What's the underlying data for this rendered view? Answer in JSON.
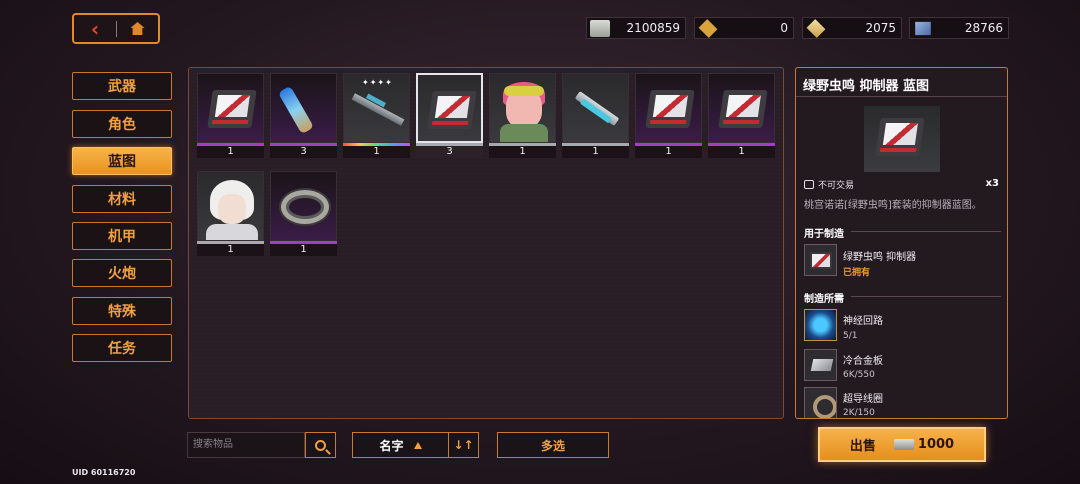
{
  "nav": {
    "back_icon": "chevron-left-icon",
    "home_icon": "home-icon"
  },
  "currencies": [
    {
      "icon": "cash-icon",
      "value": "2100859"
    },
    {
      "icon": "gold-crystal-icon",
      "value": "0"
    },
    {
      "icon": "crystal-shard-icon",
      "value": "2075"
    },
    {
      "icon": "cube-icon",
      "value": "28766"
    }
  ],
  "sidebar": {
    "active": "蓝图",
    "items": [
      {
        "label": "武器"
      },
      {
        "label": "角色"
      },
      {
        "label": "蓝图"
      },
      {
        "label": "材料"
      },
      {
        "label": "机甲"
      },
      {
        "label": "火炮"
      },
      {
        "label": "特殊"
      },
      {
        "label": "任务"
      }
    ]
  },
  "grid": {
    "items": [
      {
        "art": "suppressor-case",
        "count": "1",
        "rarity": "purple",
        "selected": false
      },
      {
        "art": "lightning-bolt",
        "count": "3",
        "rarity": "purple",
        "selected": false
      },
      {
        "art": "rifle",
        "count": "1",
        "rarity": "rainbow",
        "selected": false
      },
      {
        "art": "suppressor-case",
        "count": "3",
        "rarity": "gray",
        "selected": true
      },
      {
        "art": "character-pink",
        "count": "1",
        "rarity": "gray",
        "selected": false
      },
      {
        "art": "gun",
        "count": "1",
        "rarity": "gray",
        "selected": false
      },
      {
        "art": "suppressor-case",
        "count": "1",
        "rarity": "purple",
        "selected": false
      },
      {
        "art": "suppressor-case",
        "count": "1",
        "rarity": "purple",
        "selected": false
      },
      {
        "art": "character-white",
        "count": "1",
        "rarity": "gray",
        "selected": false
      },
      {
        "art": "coil",
        "count": "1",
        "rarity": "purple",
        "selected": false
      }
    ]
  },
  "detail": {
    "title": "绿野虫鸣 抑制器 蓝图",
    "trade_status": "不可交易",
    "quantity": "x3",
    "description": "桃宫诺诺[绿野虫鸣]套装的抑制器蓝图。",
    "used_for_heading": "用于制造",
    "used_for": {
      "name": "绿野虫鸣 抑制器",
      "status": "已拥有"
    },
    "requires_heading": "制造所需",
    "requirements": [
      {
        "name": "神经回路",
        "amount": "5/1",
        "icon": "neural-circuit-icon"
      },
      {
        "name": "冷合金板",
        "amount": "6K/550",
        "icon": "alloy-plate-icon"
      },
      {
        "name": "超导线圈",
        "amount": "2K/150",
        "icon": "coil-icon"
      }
    ]
  },
  "bottom": {
    "search_placeholder": "搜索物品",
    "sort_label": "名字",
    "multi_select_label": "多选",
    "sell_label": "出售",
    "sell_price": "1000",
    "uid": "UID 60116720"
  },
  "colors": {
    "accent": "#e9921f",
    "rarity_purple": "#a43cc8",
    "rarity_gray": "#a8a8b0"
  }
}
